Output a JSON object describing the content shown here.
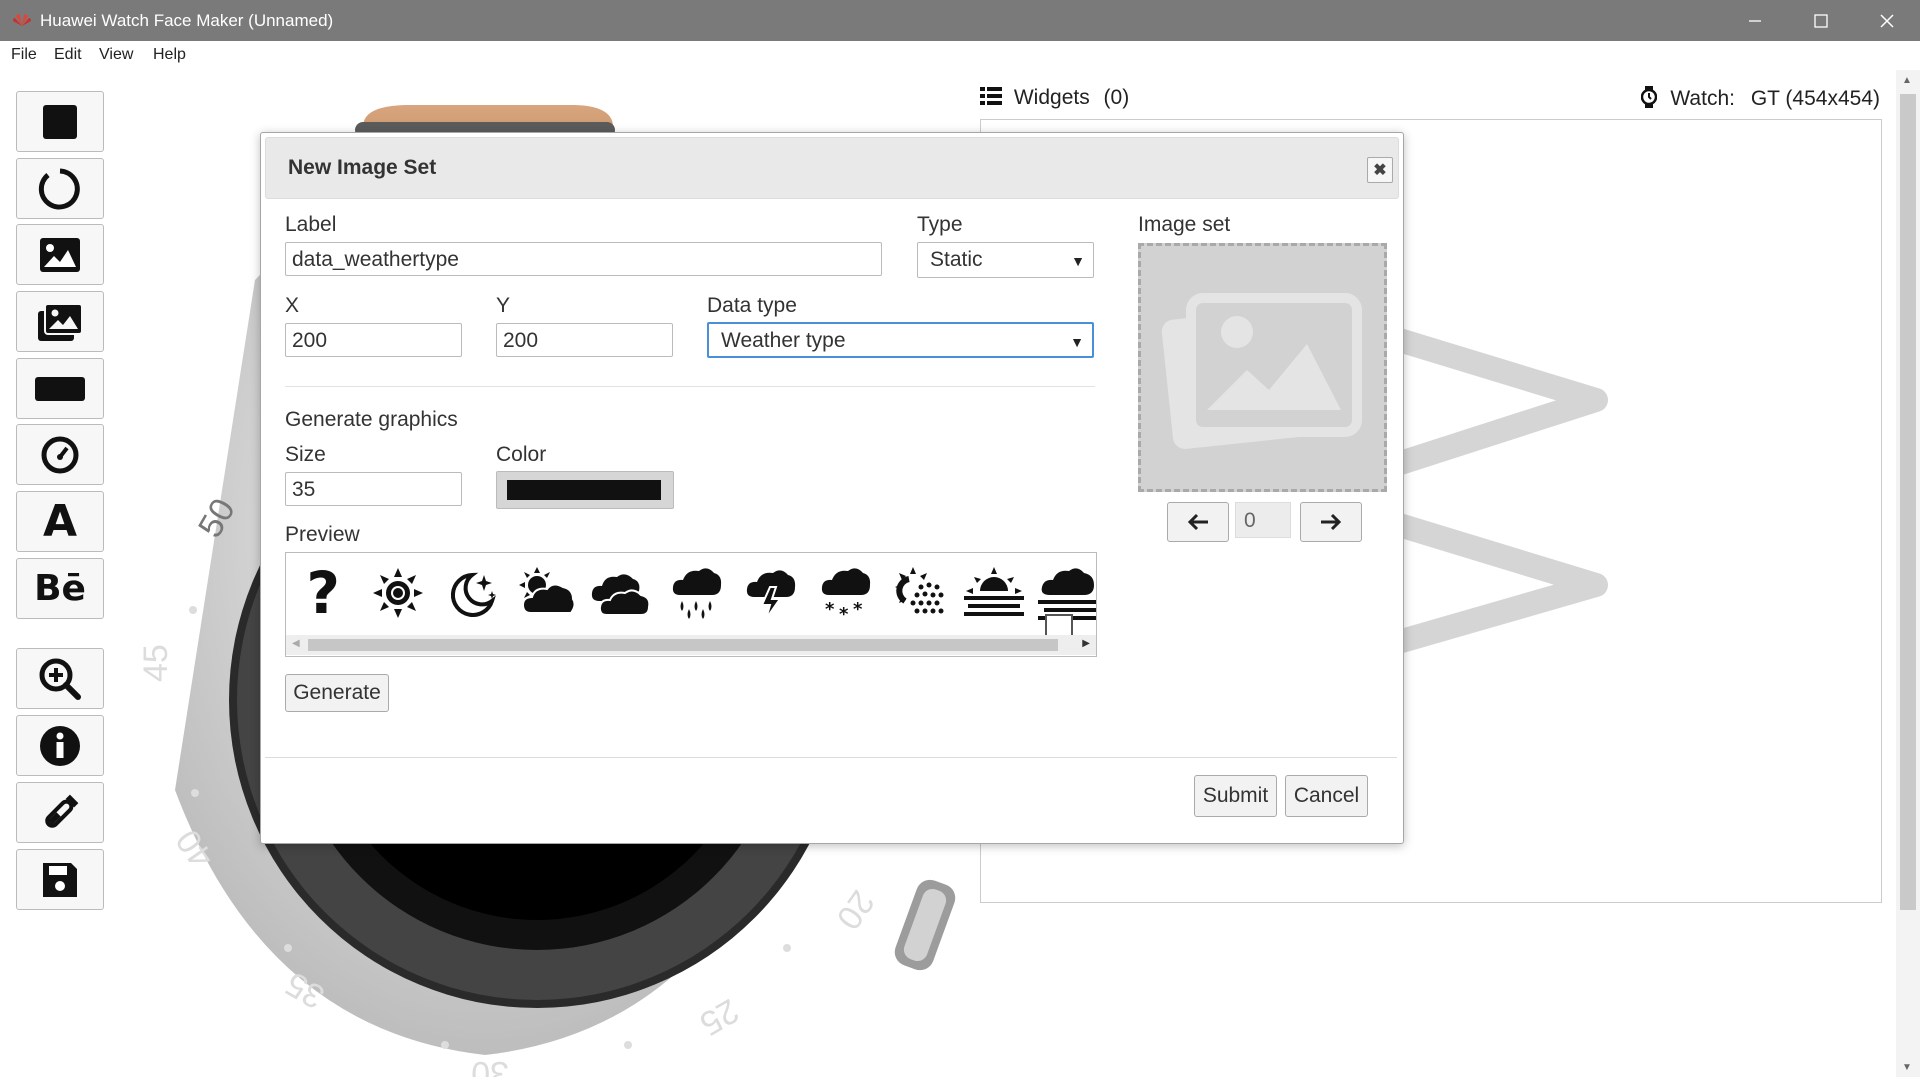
{
  "window": {
    "title": "Huawei Watch Face Maker (Unnamed)"
  },
  "menu": {
    "file": "File",
    "edit": "Edit",
    "view": "View",
    "help": "Help"
  },
  "toolbar": {
    "icons": [
      "square-icon",
      "circle-outline-icon",
      "image-icon",
      "image-set-icon",
      "rectangle-icon",
      "gauge-icon",
      "text-icon",
      "behance-icon",
      "zoom-in-icon",
      "info-icon",
      "flask-icon",
      "save-icon"
    ]
  },
  "panel": {
    "widgets_label": "Widgets",
    "widgets_count": "(0)",
    "watch_label": "Watch:",
    "watch_model": "GT (454x454)"
  },
  "watch_bezel": {
    "labels": [
      "50",
      "45",
      "40",
      "35",
      "30",
      "25",
      "20"
    ]
  },
  "dialog": {
    "title": "New Image Set",
    "label_label": "Label",
    "label_value": "data_weathertype",
    "type_label": "Type",
    "type_value": "Static",
    "x_label": "X",
    "x_value": "200",
    "y_label": "Y",
    "y_value": "200",
    "datatype_label": "Data type",
    "datatype_value": "Weather type",
    "generate_graphics_label": "Generate graphics",
    "size_label": "Size",
    "size_value": "35",
    "color_label": "Color",
    "color_value": "#111111",
    "preview_label": "Preview",
    "preview_icons": [
      "question-icon",
      "sun-icon",
      "moon-stars-icon",
      "sun-cloud-icon",
      "clouds-icon",
      "rain-icon",
      "thunderstorm-icon",
      "snow-icon",
      "sun-haze-icon",
      "sunset-fog-icon",
      "cloud-fog-icon"
    ],
    "generate_button": "Generate",
    "image_set_label": "Image set",
    "image_index": "0",
    "submit_button": "Submit",
    "cancel_button": "Cancel"
  }
}
